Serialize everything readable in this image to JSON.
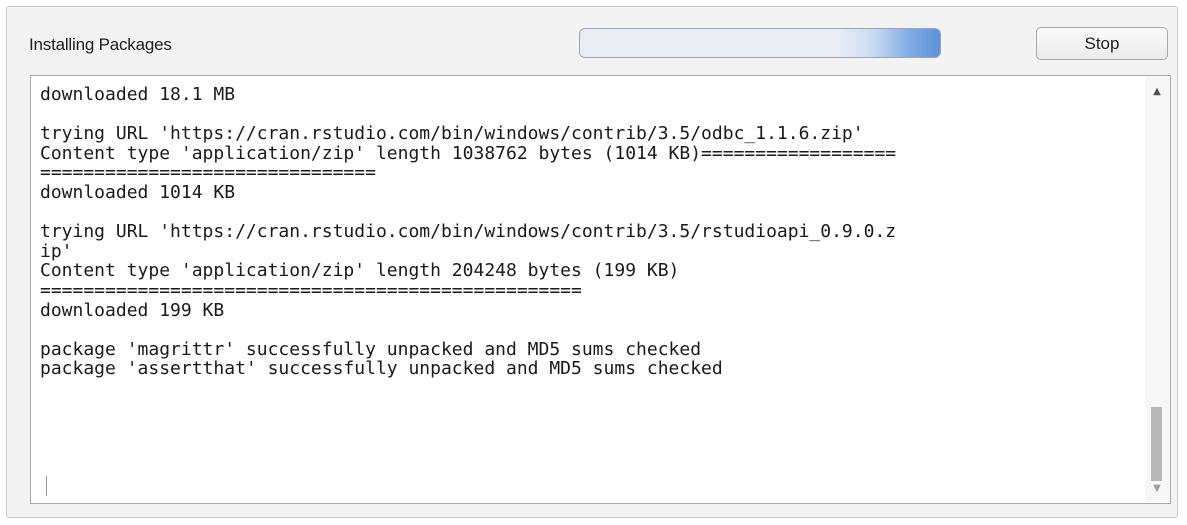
{
  "dialog": {
    "title": "Installing Packages",
    "progress": 1.0,
    "stop_label": "Stop"
  },
  "console": {
    "lines": [
      "downloaded 18.1 MB",
      "",
      "trying URL 'https://cran.rstudio.com/bin/windows/contrib/3.5/odbc_1.1.6.zip'",
      "Content type 'application/zip' length 1038762 bytes (1014 KB)==================",
      "===============================",
      "downloaded 1014 KB",
      "",
      "trying URL 'https://cran.rstudio.com/bin/windows/contrib/3.5/rstudioapi_0.9.0.z",
      "ip'",
      "Content type 'application/zip' length 204248 bytes (199 KB)",
      "==================================================",
      "downloaded 199 KB",
      "",
      "package 'magrittr' successfully unpacked and MD5 sums checked",
      "package 'assertthat' successfully unpacked and MD5 sums checked"
    ]
  },
  "scrollbar": {
    "up_icon": "▲",
    "down_icon": "▼"
  },
  "colors": {
    "progress_accent": "#5f92da",
    "window_bg": "#f3f3f3"
  }
}
